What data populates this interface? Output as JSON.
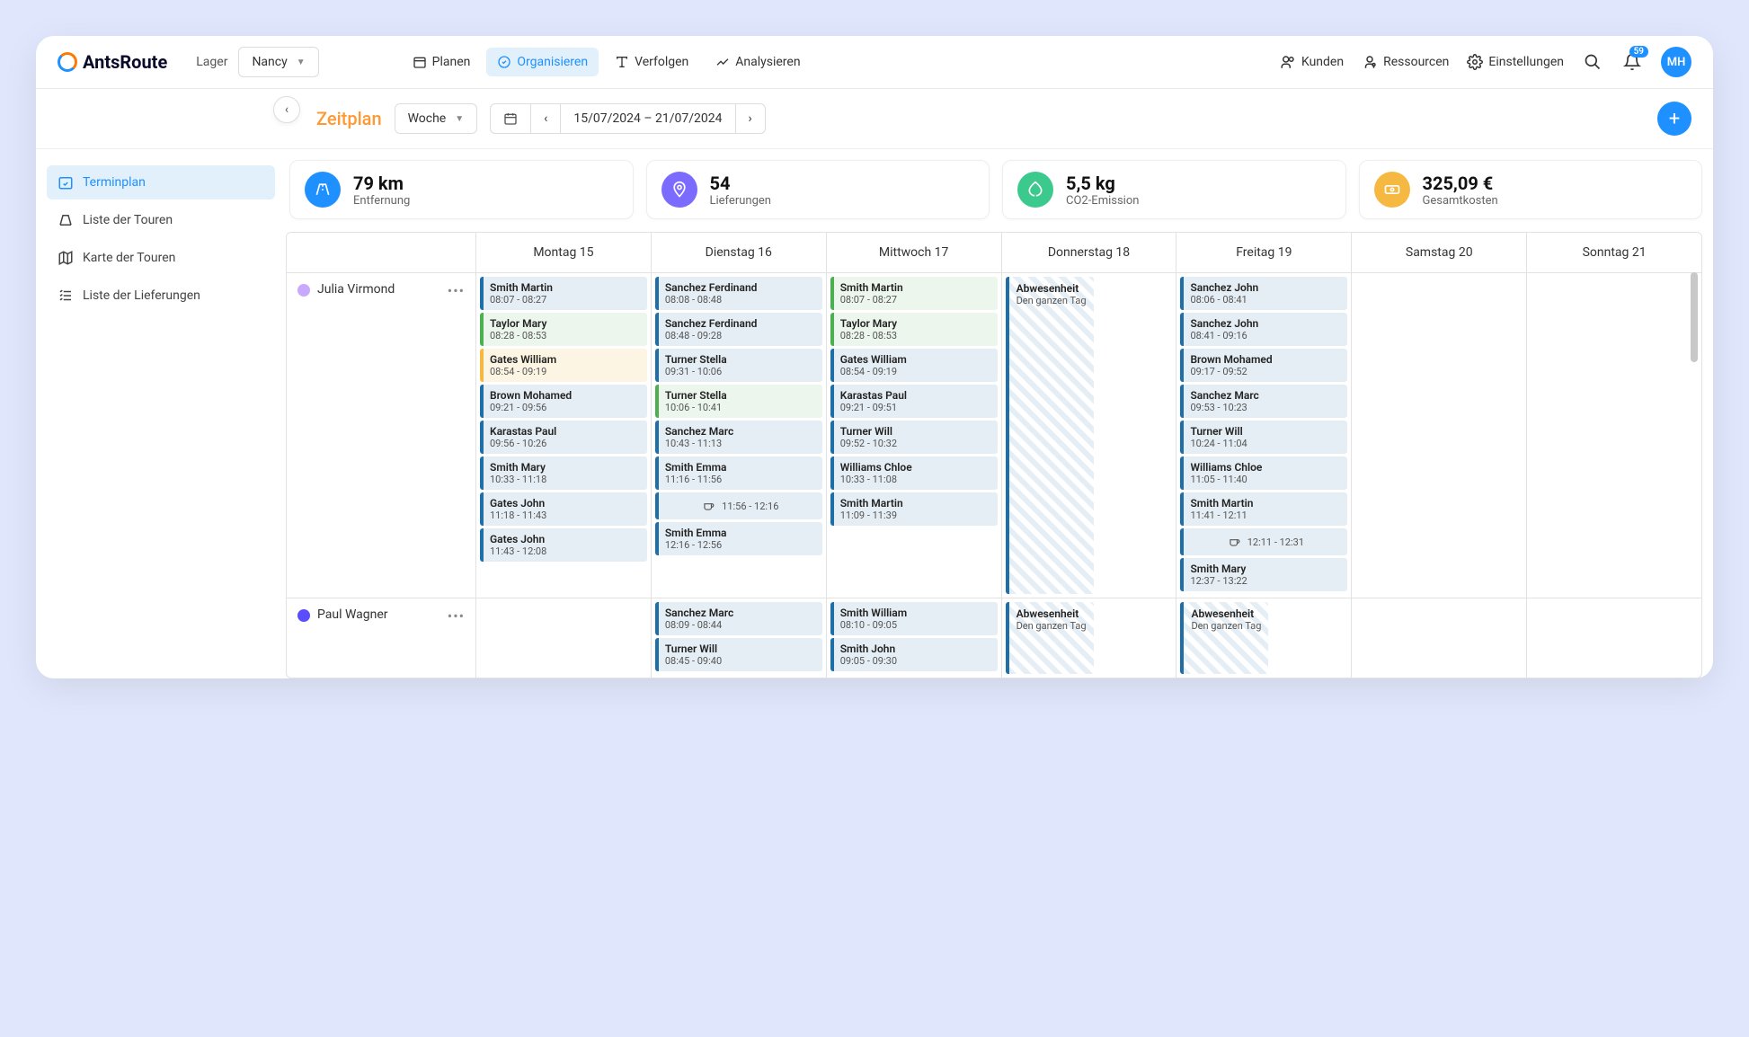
{
  "header": {
    "brand": "AntsRoute",
    "lager_label": "Lager",
    "lager_value": "Nancy",
    "tabs": [
      {
        "label": "Planen"
      },
      {
        "label": "Organisieren",
        "active": true
      },
      {
        "label": "Verfolgen"
      },
      {
        "label": "Analysieren"
      }
    ],
    "links": [
      {
        "label": "Kunden"
      },
      {
        "label": "Ressourcen"
      },
      {
        "label": "Einstellungen"
      }
    ],
    "notif_count": "59",
    "avatar": "MH"
  },
  "subbar": {
    "title": "Zeitplan",
    "view": "Woche",
    "range": "15/07/2024 – 21/07/2024"
  },
  "sidebar": [
    {
      "label": "Terminplan",
      "active": true,
      "icon": "calendar-check"
    },
    {
      "label": "Liste der Touren",
      "icon": "route"
    },
    {
      "label": "Karte der Touren",
      "icon": "map"
    },
    {
      "label": "Liste der Lieferungen",
      "icon": "list"
    }
  ],
  "stats": [
    {
      "value": "79 km",
      "label": "Entfernung",
      "color": "#1e90ff",
      "icon": "road"
    },
    {
      "value": "54",
      "label": "Lieferungen",
      "color": "#7c6bff",
      "icon": "pin"
    },
    {
      "value": "5,5 kg",
      "label": "CO2-Emission",
      "color": "#3cc98e",
      "icon": "leaf"
    },
    {
      "value": "325,09 €",
      "label": "Gesamtkosten",
      "color": "#f5b941",
      "icon": "money"
    }
  ],
  "days": [
    "Montag 15",
    "Dienstag 16",
    "Mittwoch 17",
    "Donnerstag 18",
    "Freitag 19",
    "Samstag 20",
    "Sonntag 21"
  ],
  "absence": {
    "title": "Abwesenheit",
    "sub": "Den ganzen Tag"
  },
  "employees": [
    {
      "name": "Julia Virmond",
      "color": "#c9a8ff",
      "days": [
        [
          {
            "name": "Smith Martin",
            "time": "08:07 - 08:27",
            "style": ""
          },
          {
            "name": "Taylor Mary",
            "time": "08:28 - 08:53",
            "style": "green"
          },
          {
            "name": "Gates William",
            "time": "08:54 - 09:19",
            "style": "yellow"
          },
          {
            "name": "Brown Mohamed",
            "time": "09:21 - 09:56",
            "style": ""
          },
          {
            "name": "Karastas Paul",
            "time": "09:56 - 10:26",
            "style": ""
          },
          {
            "name": "Smith Mary",
            "time": "10:33 - 11:18",
            "style": ""
          },
          {
            "name": "Gates John",
            "time": "11:18 - 11:43",
            "style": ""
          },
          {
            "name": "Gates John",
            "time": "11:43 - 12:08",
            "style": ""
          }
        ],
        [
          {
            "name": "Sanchez Ferdinand",
            "time": "08:08 - 08:48",
            "style": ""
          },
          {
            "name": "Sanchez Ferdinand",
            "time": "08:48 - 09:28",
            "style": ""
          },
          {
            "name": "Turner Stella",
            "time": "09:31 - 10:06",
            "style": ""
          },
          {
            "name": "Turner Stella",
            "time": "10:06 - 10:41",
            "style": "green"
          },
          {
            "name": "Sanchez Marc",
            "time": "10:43 - 11:13",
            "style": ""
          },
          {
            "name": "Smith Emma",
            "time": "11:16 - 11:56",
            "style": ""
          },
          {
            "break": true,
            "time": "11:56 - 12:16"
          },
          {
            "name": "Smith Emma",
            "time": "12:16 - 12:56",
            "style": ""
          }
        ],
        [
          {
            "name": "Smith Martin",
            "time": "08:07 - 08:27",
            "style": "green"
          },
          {
            "name": "Taylor Mary",
            "time": "08:28 - 08:53",
            "style": "green"
          },
          {
            "name": "Gates William",
            "time": "08:54 - 09:19",
            "style": ""
          },
          {
            "name": "Karastas Paul",
            "time": "09:21 - 09:51",
            "style": ""
          },
          {
            "name": "Turner Will",
            "time": "09:52 - 10:32",
            "style": ""
          },
          {
            "name": "Williams Chloe",
            "time": "10:33 - 11:08",
            "style": ""
          },
          {
            "name": "Smith Martin",
            "time": "11:09 - 11:39",
            "style": ""
          }
        ],
        {
          "absence": true
        },
        [
          {
            "name": "Sanchez John",
            "time": "08:06 - 08:41",
            "style": ""
          },
          {
            "name": "Sanchez John",
            "time": "08:41 - 09:16",
            "style": ""
          },
          {
            "name": "Brown Mohamed",
            "time": "09:17 - 09:52",
            "style": ""
          },
          {
            "name": "Sanchez Marc",
            "time": "09:53 - 10:23",
            "style": ""
          },
          {
            "name": "Turner Will",
            "time": "10:24 - 11:04",
            "style": ""
          },
          {
            "name": "Williams Chloe",
            "time": "11:05 - 11:40",
            "style": ""
          },
          {
            "name": "Smith Martin",
            "time": "11:41 - 12:11",
            "style": ""
          },
          {
            "break": true,
            "time": "12:11 - 12:31"
          },
          {
            "name": "Smith Mary",
            "time": "12:37 - 13:22",
            "style": ""
          }
        ],
        [],
        []
      ]
    },
    {
      "name": "Paul Wagner",
      "color": "#5b4dff",
      "days": [
        [],
        [
          {
            "name": "Sanchez Marc",
            "time": "08:09 - 08:44",
            "style": ""
          },
          {
            "name": "Turner Will",
            "time": "08:45 - 09:40",
            "style": ""
          }
        ],
        [
          {
            "name": "Smith William",
            "time": "08:10 - 09:05",
            "style": ""
          },
          {
            "name": "Smith John",
            "time": "09:05 - 09:30",
            "style": ""
          }
        ],
        {
          "absence": true
        },
        {
          "absence": true
        },
        [],
        []
      ]
    }
  ]
}
